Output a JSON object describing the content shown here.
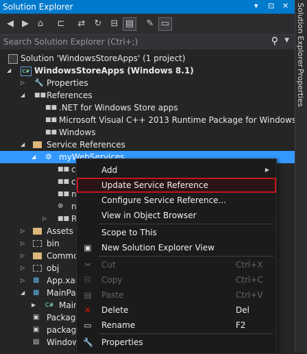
{
  "window": {
    "title": "Solution Explorer",
    "controls": [
      "▾",
      "⊡",
      "✕"
    ]
  },
  "toolbar": {
    "buttons": [
      "back-icon",
      "forward-icon",
      "home-icon",
      "pending-changes-icon",
      "sync-icon",
      "refresh-icon",
      "collapse-all-icon",
      "show-all-files-icon",
      "properties-icon",
      "preview-icon"
    ]
  },
  "search": {
    "placeholder": "Search Solution Explorer (Ctrl+;)",
    "button_glyph": "⚲",
    "dropdown_glyph": "▼"
  },
  "side_tabs": [
    "Solution Explorer",
    "Properties"
  ],
  "tree": {
    "nodes": [
      {
        "label": "Solution 'WindowsStoreApps' (1 project)",
        "icon": "solution-icon"
      },
      {
        "label": "WindowsStoreApps (Windows 8.1)",
        "icon": "csharp-project-icon",
        "expanded": true
      },
      {
        "label": "Properties",
        "icon": "wrench-icon",
        "expanded": false
      },
      {
        "label": "References",
        "icon": "references-icon",
        "expanded": true
      },
      {
        "label": ".NET for Windows Store apps",
        "icon": "assembly-icon"
      },
      {
        "label": "Microsoft Visual C++ 2013 Runtime Package for Windows",
        "icon": "assembly-icon"
      },
      {
        "label": "Windows",
        "icon": "assembly-icon"
      },
      {
        "label": "Service References",
        "icon": "folder-icon",
        "expanded": true
      },
      {
        "label": "myWebServices",
        "icon": "service-reference-icon",
        "expanded": true,
        "selected": true
      },
      {
        "label": "c",
        "icon": "file-icon"
      },
      {
        "label": "c",
        "icon": "file-icon"
      },
      {
        "label": "n",
        "icon": "file-icon"
      },
      {
        "label": "n",
        "icon": "globe-file-icon"
      },
      {
        "label": "R",
        "icon": "file-icon",
        "expanded": false
      },
      {
        "label": "Assets",
        "icon": "folder-icon",
        "expanded": false
      },
      {
        "label": "bin",
        "icon": "folder-dashed-icon",
        "expanded": false
      },
      {
        "label": "Commo",
        "icon": "folder-icon",
        "expanded": false
      },
      {
        "label": "obj",
        "icon": "folder-dashed-icon",
        "expanded": false
      },
      {
        "label": "App.xam",
        "icon": "xaml-file-icon",
        "expanded": false
      },
      {
        "label": "MainPag",
        "icon": "xaml-file-icon",
        "expanded": true
      },
      {
        "label": "Main",
        "icon": "csharp-file-icon",
        "expanded": false
      },
      {
        "label": "Package",
        "icon": "package-icon"
      },
      {
        "label": "package",
        "icon": "package-icon"
      },
      {
        "label": "Window",
        "icon": "file-icon"
      }
    ]
  },
  "context_menu": {
    "items": [
      {
        "label": "Add",
        "has_submenu": true
      },
      {
        "label": "Update Service Reference",
        "highlighted": true
      },
      {
        "label": "Configure Service Reference..."
      },
      {
        "label": "View in Object Browser"
      },
      {
        "label": "Scope to This"
      },
      {
        "label": "New Solution Explorer View",
        "icon": "new-view-icon"
      },
      {
        "label": "Cut",
        "shortcut": "Ctrl+X",
        "disabled": true,
        "icon": "cut-icon"
      },
      {
        "label": "Copy",
        "shortcut": "Ctrl+C",
        "disabled": true,
        "icon": "copy-icon"
      },
      {
        "label": "Paste",
        "shortcut": "Ctrl+V",
        "disabled": true,
        "icon": "paste-icon"
      },
      {
        "label": "Delete",
        "shortcut": "Del",
        "icon": "delete-icon"
      },
      {
        "label": "Rename",
        "shortcut": "F2",
        "icon": "rename-icon"
      },
      {
        "label": "Properties",
        "icon": "wrench-icon"
      }
    ]
  },
  "colors": {
    "title_bar": "#007acc",
    "selection": "#3399ff",
    "highlight_border": "#c5141d",
    "background": "#252526"
  }
}
